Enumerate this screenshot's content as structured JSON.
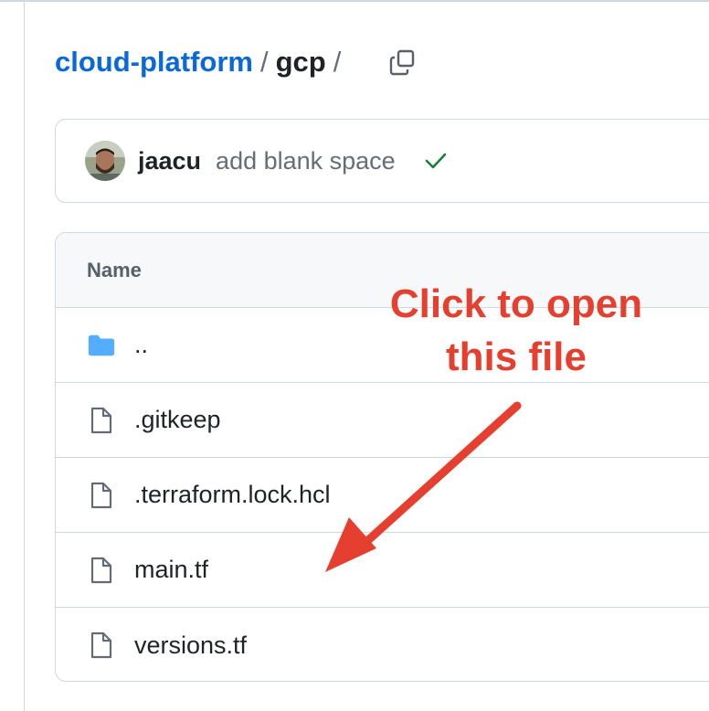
{
  "breadcrumb": {
    "repo": "cloud-platform",
    "separator": "/",
    "folder": "gcp",
    "trailing": "/"
  },
  "commit": {
    "author": "jaacu",
    "message": "add blank space",
    "status": "success"
  },
  "table": {
    "header": "Name",
    "rows": [
      {
        "name": "..",
        "type": "folder"
      },
      {
        "name": ".gitkeep",
        "type": "file"
      },
      {
        "name": ".terraform.lock.hcl",
        "type": "file"
      },
      {
        "name": "main.tf",
        "type": "file"
      },
      {
        "name": "versions.tf",
        "type": "file"
      }
    ]
  },
  "annotation": {
    "line1": "Click to open",
    "line2": "this file"
  },
  "colors": {
    "link": "#0969da",
    "annotation": "#e5402f",
    "success": "#1a7f37",
    "folder": "#54aeff"
  }
}
